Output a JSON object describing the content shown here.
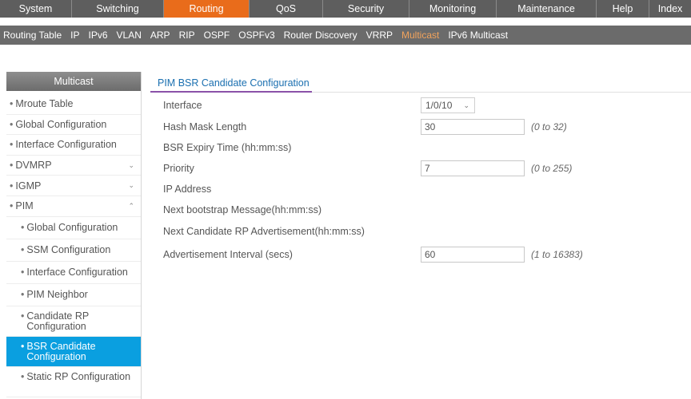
{
  "topnav": {
    "tabs": [
      {
        "label": "System",
        "width": 90
      },
      {
        "label": "Switching",
        "width": 115
      },
      {
        "label": "Routing",
        "width": 107,
        "active": true
      },
      {
        "label": "QoS",
        "width": 92
      },
      {
        "label": "Security",
        "width": 108
      },
      {
        "label": "Monitoring",
        "width": 109
      },
      {
        "label": "Maintenance",
        "width": 125
      },
      {
        "label": "Help",
        "width": 66
      },
      {
        "label": "Index",
        "width": 52
      }
    ]
  },
  "subnav": {
    "items": [
      {
        "label": "Routing Table"
      },
      {
        "label": "IP"
      },
      {
        "label": "IPv6"
      },
      {
        "label": "VLAN"
      },
      {
        "label": "ARP"
      },
      {
        "label": "RIP"
      },
      {
        "label": "OSPF"
      },
      {
        "label": "OSPFv3"
      },
      {
        "label": "Router Discovery"
      },
      {
        "label": "VRRP"
      },
      {
        "label": "Multicast",
        "active": true
      },
      {
        "label": "IPv6 Multicast"
      }
    ]
  },
  "sidebar": {
    "title": "Multicast",
    "bullet": "•",
    "items": [
      {
        "label": "Mroute Table"
      },
      {
        "label": "Global Configuration"
      },
      {
        "label": "Interface Configuration"
      },
      {
        "label": "DVMRP",
        "chevron": "⌄"
      },
      {
        "label": "IGMP",
        "chevron": "⌄"
      },
      {
        "label": "PIM",
        "chevron": "⌃"
      }
    ],
    "pim_children": [
      {
        "label": "Global Configuration"
      },
      {
        "label": "SSM Configuration"
      },
      {
        "label": "Interface Configuration"
      },
      {
        "label": "PIM Neighbor"
      },
      {
        "label": "Candidate RP Configuration"
      },
      {
        "label": "BSR Candidate Configuration",
        "active": true
      },
      {
        "label": "Static RP Configuration"
      }
    ]
  },
  "panel": {
    "title": "PIM BSR Candidate Configuration",
    "fields": [
      {
        "label": "Interface",
        "type": "select",
        "value": "1/0/10",
        "hint": ""
      },
      {
        "label": "Hash Mask Length",
        "type": "input",
        "value": "30",
        "hint": "(0 to 32)"
      },
      {
        "label": "BSR Expiry Time (hh:mm:ss)",
        "type": "text",
        "value": "",
        "hint": ""
      },
      {
        "label": "Priority",
        "type": "input",
        "value": "7",
        "hint": "(0 to 255)"
      },
      {
        "label": "IP Address",
        "type": "text",
        "value": "",
        "hint": ""
      },
      {
        "label": "Next bootstrap Message(hh:mm:ss)",
        "type": "text",
        "value": "",
        "hint": ""
      },
      {
        "label": "Next Candidate RP Advertisement(hh:mm:ss)",
        "type": "text",
        "value": "",
        "hint": ""
      },
      {
        "label": "Advertisement Interval (secs)",
        "type": "input",
        "value": "60",
        "hint": "(1 to 16383)"
      }
    ]
  },
  "colors": {
    "accent": "#e96c1b",
    "active_sidebar": "#0a9fe0",
    "title_text": "#1a6fb0",
    "title_underline": "#8a52a8"
  },
  "icons": {
    "select_chevron": "⌄"
  }
}
